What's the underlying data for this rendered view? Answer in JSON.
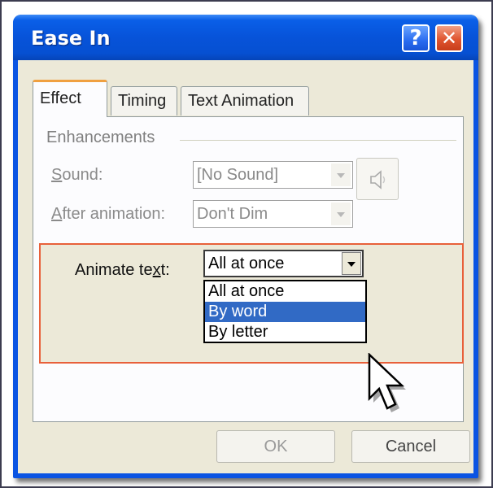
{
  "window": {
    "title": "Ease In",
    "help_glyph": "?",
    "close_glyph": "✕"
  },
  "tabs": [
    {
      "label": "Effect",
      "active": true
    },
    {
      "label": "Timing",
      "active": false
    },
    {
      "label": "Text Animation",
      "active": false
    }
  ],
  "enhancements": {
    "section_label": "Enhancements",
    "sound": {
      "label": "Sound:",
      "value": "[No Sound]",
      "enabled": false
    },
    "after_animation": {
      "label": "After animation:",
      "value": "Don't Dim",
      "enabled": false
    },
    "animate_text": {
      "label": "Animate text:",
      "value": "All at once",
      "options": [
        "All at once",
        "By word",
        "By letter"
      ],
      "highlighted_option": "By word"
    },
    "speaker_icon": "speaker-icon"
  },
  "buttons": {
    "ok_label": "OK",
    "cancel_label": "Cancel"
  },
  "colors": {
    "titlebar": "#0a54e3",
    "dialog_bg": "#ece9d8",
    "highlight_border": "#e8603a",
    "selection": "#316ac5",
    "active_tab_accent": "#f0a040"
  }
}
